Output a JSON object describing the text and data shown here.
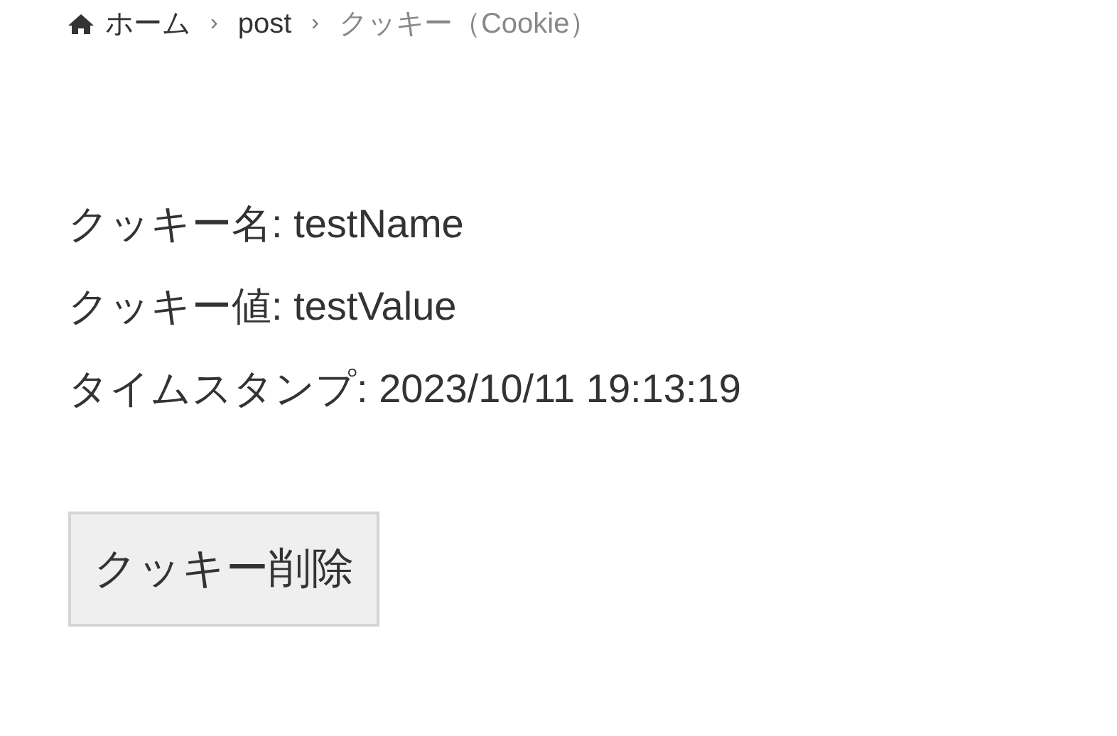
{
  "breadcrumb": [
    {
      "label": "ホーム",
      "kind": "home"
    },
    {
      "label": "post",
      "kind": "link"
    },
    {
      "label": "クッキー（Cookie）",
      "kind": "current"
    }
  ],
  "separator": "›",
  "fields": [
    {
      "label": "クッキー名:",
      "value": "testName"
    },
    {
      "label": "クッキー値:",
      "value": "testValue"
    },
    {
      "label": "タイムスタンプ:",
      "value": "2023/10/11 19:13:19"
    }
  ],
  "button": "クッキー削除"
}
